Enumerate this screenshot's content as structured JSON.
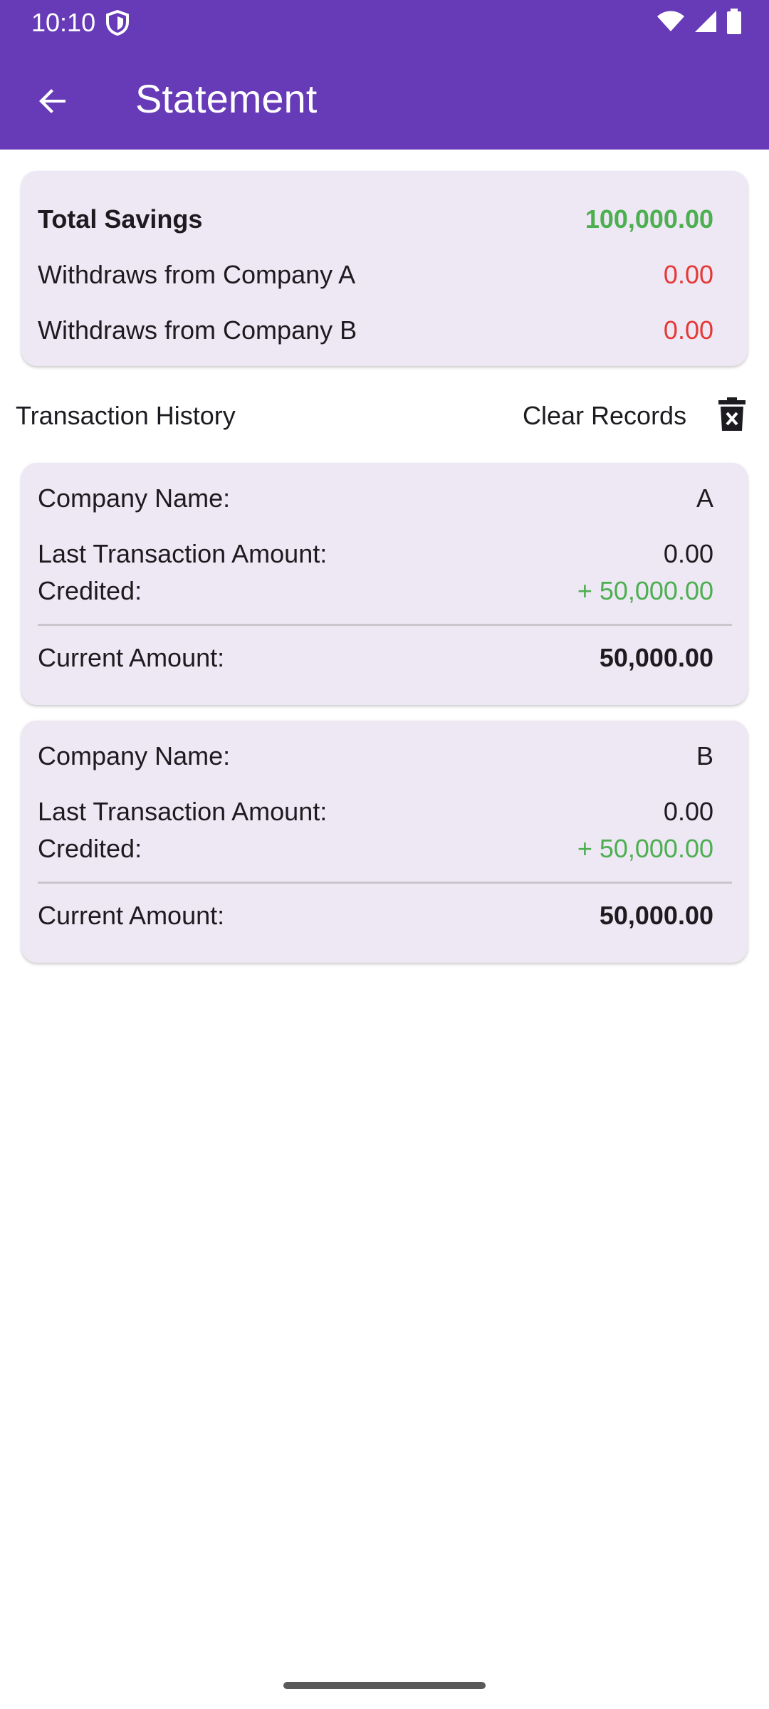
{
  "status_bar": {
    "time": "10:10"
  },
  "app_bar": {
    "title": "Statement",
    "back_icon": "arrow-back-icon"
  },
  "summary": {
    "total_label": "Total Savings",
    "total_value": "100,000.00",
    "withdraw_a_label": "Withdraws from Company A",
    "withdraw_a_value": "0.00",
    "withdraw_b_label": "Withdraws from Company B",
    "withdraw_b_value": "0.00"
  },
  "history": {
    "title": "Transaction History",
    "clear_label": "Clear Records",
    "clear_icon": "trash-icon"
  },
  "companies": [
    {
      "company_label": "Company Name:",
      "company_value": "A",
      "last_label": "Last Transaction Amount:",
      "last_value": "0.00",
      "credited_label": "Credited:",
      "credited_value": "+ 50,000.00",
      "current_label": "Current Amount:",
      "current_value": "50,000.00"
    },
    {
      "company_label": "Company Name:",
      "company_value": "B",
      "last_label": "Last Transaction Amount:",
      "last_value": "0.00",
      "credited_label": "Credited:",
      "credited_value": "+ 50,000.00",
      "current_label": "Current Amount:",
      "current_value": "50,000.00"
    }
  ],
  "colors": {
    "app_bar": "#673ab7",
    "card": "#eee7f4",
    "positive": "#4caf50",
    "negative": "#e53935"
  }
}
